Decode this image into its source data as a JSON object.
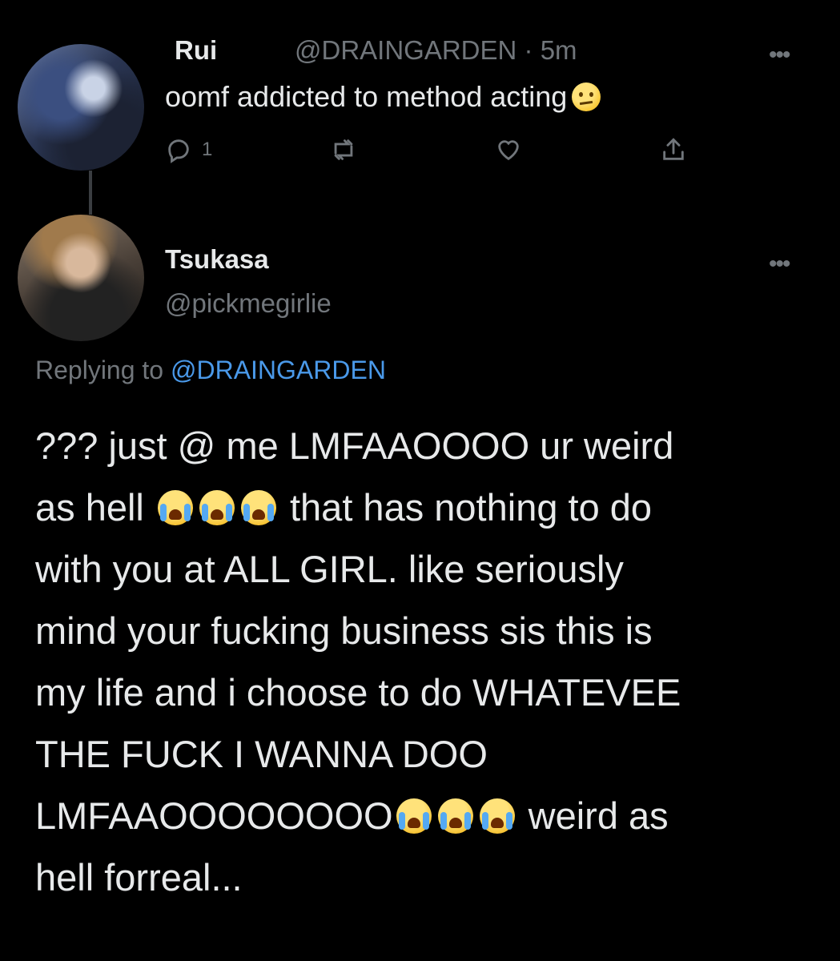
{
  "tweet1": {
    "name": "Rui",
    "handle": "@DRAINGARDEN",
    "time": "· 5m",
    "text": "oomf addicted to method acting",
    "emoji": "confused-face-emoji",
    "reply_count": "1",
    "more": "•••"
  },
  "tweet2": {
    "name": "Tsukasa",
    "handle": "@pickmegirlie",
    "more": "•••",
    "replying_label": "Replying to ",
    "replying_to": "@DRAINGARDEN",
    "lines": [
      "??? just @ me LMFAAOOOO ur weird",
      "as hell",
      "that has nothing to do",
      "with you at ALL GIRL. like seriously",
      "mind your fucking business sis this is",
      "my life and i choose to do WHATEVEE",
      "THE FUCK I WANNA DOO",
      "LMFAAOOOOOOOO",
      "weird as",
      "hell forreal..."
    ],
    "emoji": "loudly-crying-face-emoji"
  },
  "colors": {
    "background": "#000000",
    "text": "#e7e9ea",
    "secondary": "#71767b",
    "link": "#4a99e9"
  }
}
